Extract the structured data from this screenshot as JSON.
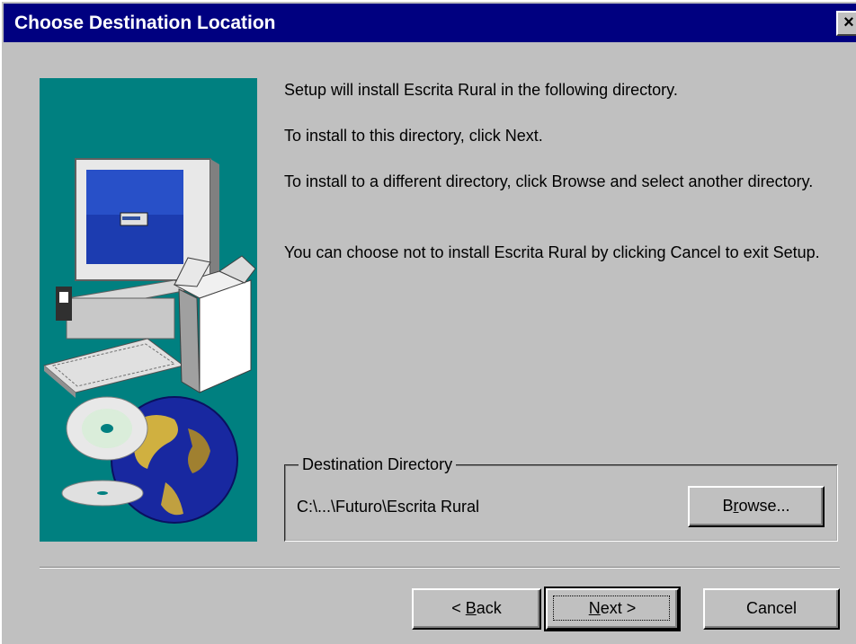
{
  "window": {
    "title": "Choose Destination Location",
    "close_symbol": "×",
    "close_icon": "close-icon"
  },
  "illustration": {
    "description_icon": "computer-with-globe-and-cds-icon",
    "background": "#008080"
  },
  "content": {
    "line1": "Setup will install Escrita Rural in the following directory.",
    "line2": "To install to this directory, click Next.",
    "line3": "To install to a different directory, click Browse and select another directory.",
    "line4": "You can choose not to install Escrita Rural by clicking Cancel to exit Setup."
  },
  "destination": {
    "group_label": "Destination Directory",
    "path": "C:\\...\\Futuro\\Escrita Rural",
    "browse_pre": "B",
    "browse_accel": "r",
    "browse_post": "owse..."
  },
  "buttons": {
    "back_pre": "< ",
    "back_accel": "B",
    "back_post": "ack",
    "next_accel": "N",
    "next_post": "ext >",
    "cancel": "Cancel"
  },
  "colors": {
    "titlebar": "#000080",
    "face": "#c0c0c0",
    "illustration_bg": "#008080"
  }
}
